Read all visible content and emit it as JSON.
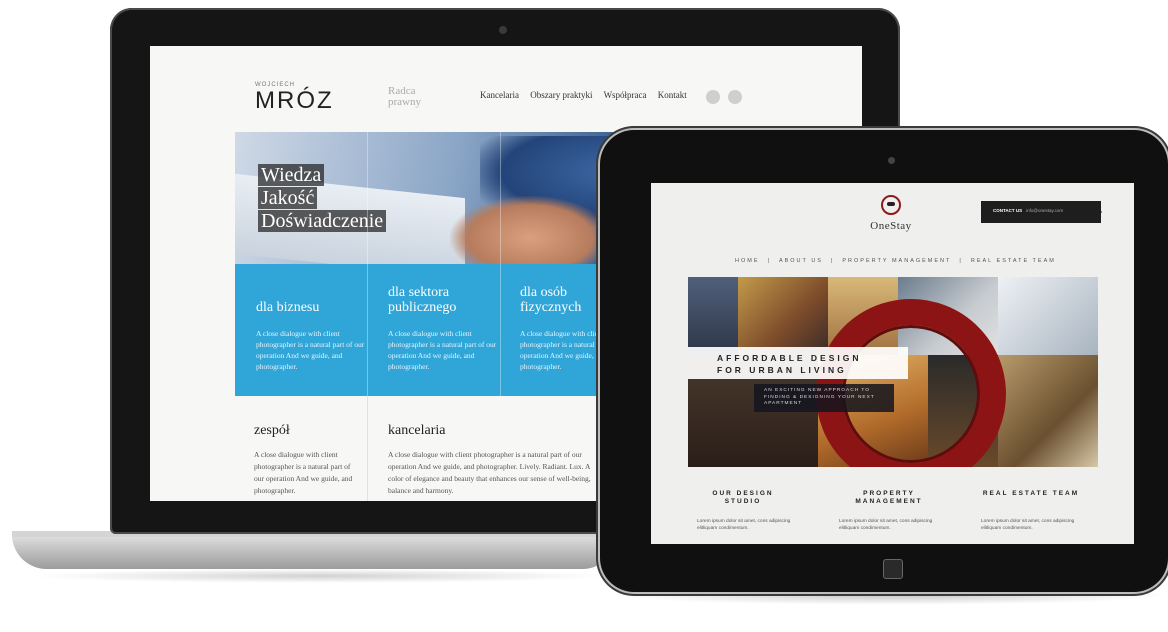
{
  "laptop_site": {
    "logo_small": "WOJCIECH",
    "logo": "MRÓZ",
    "tagline": "Radca prawny",
    "nav": [
      "Kancelaria",
      "Obszary praktyki",
      "Współpraca",
      "Kontakt"
    ],
    "hero_lines": [
      "Wiedza",
      "Jakość",
      "Doświadczenie"
    ],
    "columns": [
      {
        "title": "dla biznesu",
        "text": "A close dialogue with client photographer is a natural part of our operation And we guide, and photographer."
      },
      {
        "title": "dla sektora publicznego",
        "text": "A close dialogue with client photographer is a natural part of our operation And we guide, and photographer."
      },
      {
        "title": "dla osób fizycznych",
        "text": "A close dialogue with client photographer is a natural part of our operation And we guide, and photographer."
      }
    ],
    "bottom": [
      {
        "title": "zespół",
        "text": "A close dialogue with client photographer is a natural part of our operation And we guide, and photographer."
      },
      {
        "title": "kancelaria",
        "text": "A close dialogue with client photographer is a natural part of our operation And we guide, and photographer. Lively. Radiant. Lux. A color of elegance and beauty that enhances our sense of well-being, balance and harmony."
      }
    ],
    "colors": {
      "accent_blue": "#30a6d8"
    }
  },
  "tablet_site": {
    "logo": "OneStay",
    "contact_label": "CONTACT US",
    "contact_email": "info@onestay.com",
    "nav": [
      "HOME",
      "ABOUT US",
      "PROPERTY MANAGEMENT",
      "REAL ESTATE TEAM"
    ],
    "hero_line1": "AFFORDABLE DESIGN",
    "hero_line2": "FOR URBAN LIVING",
    "hero_sub": "AN EXCITING NEW APPROACH TO FINDING & DESIGNING YOUR NEXT APARTMENT",
    "columns": [
      {
        "title": "OUR DESIGN STUDIO",
        "text": "Lorem ipsum dolor sit amet, cons adipiscing elitliquam condimentum."
      },
      {
        "title": "PROPERTY MANAGEMENT",
        "text": "Lorem ipsum dolor sit amet, cons adipiscing elitliquam condimentum."
      },
      {
        "title": "REAL ESTATE TEAM",
        "text": "Lorem ipsum dolor sit amet, cons adipiscing elitliquam condimentum."
      }
    ],
    "colors": {
      "brand_red": "#8d1414"
    }
  }
}
